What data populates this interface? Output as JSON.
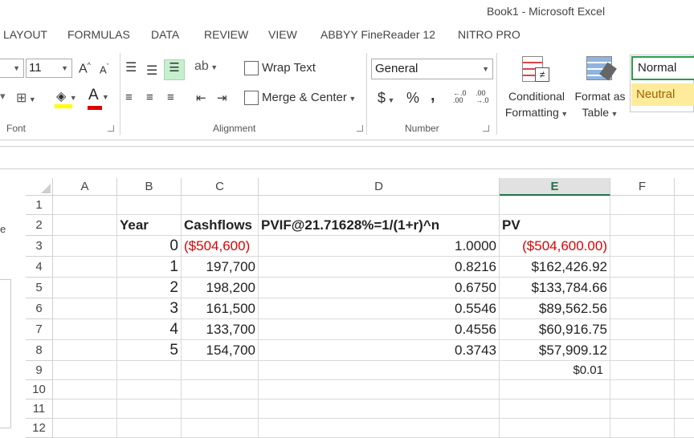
{
  "window": {
    "title": "Book1 - Microsoft Excel"
  },
  "tabs": [
    "LAYOUT",
    "FORMULAS",
    "DATA",
    "REVIEW",
    "VIEW",
    "ABBYY FineReader 12",
    "NITRO PRO"
  ],
  "ribbon": {
    "font_size": "11",
    "wrap_text": "Wrap Text",
    "merge_center": "Merge & Center",
    "number_format": "General",
    "conditional_formatting": [
      "Conditional",
      "Formatting"
    ],
    "format_as_table": [
      "Format as",
      "Table"
    ],
    "styles": {
      "normal": "Normal",
      "neutral": "Neutral"
    },
    "groups": {
      "font": "Font",
      "alignment": "Alignment",
      "number": "Number"
    },
    "currency_symbol": "$",
    "percent_symbol": "%",
    "comma_symbol": ",",
    "increase_decimal": [
      ".00",
      "←.0"
    ],
    "decrease_decimal": [
      ".00",
      "→.0"
    ],
    "font_a": "A"
  },
  "sheet": {
    "columns": [
      "A",
      "B",
      "C",
      "D",
      "E",
      "F"
    ],
    "rows": [
      "1",
      "2",
      "3",
      "4",
      "5",
      "6",
      "7",
      "8",
      "9",
      "10",
      "11",
      "12"
    ],
    "headers": {
      "year": "Year",
      "cashflows": "Cashflows",
      "pvif": "PVIF@21.71628%=1/(1+r)^n",
      "pv": "PV"
    },
    "data": [
      {
        "year": "0",
        "cashflow": "($504,600)",
        "pvif": "1.0000",
        "pv": "($504,600.00)"
      },
      {
        "year": "1",
        "cashflow": "197,700",
        "pvif": "0.8216",
        "pv": "$162,426.92"
      },
      {
        "year": "2",
        "cashflow": "198,200",
        "pvif": "0.6750",
        "pv": "$133,784.66"
      },
      {
        "year": "3",
        "cashflow": "161,500",
        "pvif": "0.5546",
        "pv": "$89,562.56"
      },
      {
        "year": "4",
        "cashflow": "133,700",
        "pvif": "0.4556",
        "pv": "$60,916.75"
      },
      {
        "year": "5",
        "cashflow": "154,700",
        "pvif": "0.3743",
        "pv": "$57,909.12"
      }
    ],
    "total_pv": "$0.01",
    "side_text": "e"
  },
  "colors": {
    "accent": "#217346",
    "negative": "#e00000",
    "neutral_fill": "#ffeb9c",
    "selected_header": "#e1e1e1"
  }
}
